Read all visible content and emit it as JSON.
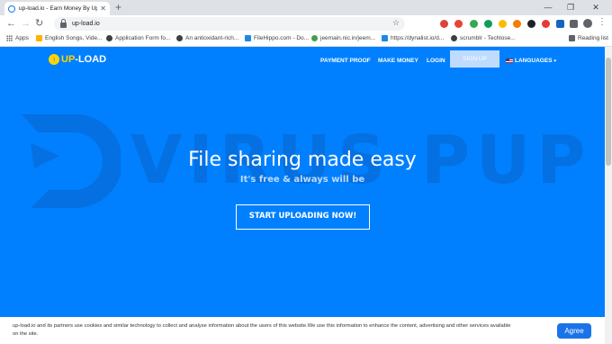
{
  "browser": {
    "tab_title": "up-load.io - Earn Money By Uplo",
    "url": "up-load.io",
    "bookmarks": [
      "Apps",
      "English Songs, Vide...",
      "Application Form fo...",
      "An antioxidant-rich...",
      "FileHippo.com - Do...",
      "jeemain.nic.in/jeem...",
      "https://dynalist.io/d...",
      "scrumblr - Techlose...",
      "Reading list"
    ]
  },
  "site": {
    "logo_up": "UP",
    "logo_load": "-LOAD",
    "nav": {
      "payment_proof": "PAYMENT PROOF",
      "make_money": "MAKE MONEY",
      "login": "LOGIN",
      "signup": "SIGN UP",
      "languages": "LANGUAGES"
    },
    "watermark": "VIRUS PUP",
    "hero": {
      "title": "File sharing made easy",
      "subtitle": "It's free & always will be",
      "cta": "START UPLOADING NOW!"
    },
    "cookie": {
      "text": "up-load.io and its partners use cookies and similar technology to collect and analyse information about the users of this website.We use this information to enhance the content, advertising and other services available on the site.",
      "agree": "Agree"
    }
  },
  "colors": {
    "page_bg": "#0080ff",
    "logo_yellow": "#ffd400",
    "agree_blue": "#1a73e8"
  }
}
